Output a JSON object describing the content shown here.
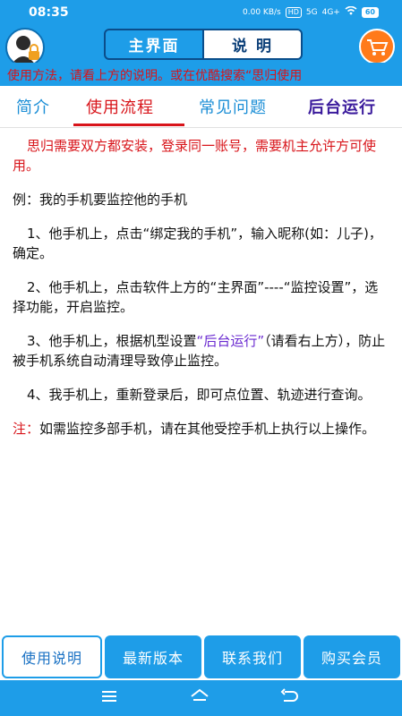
{
  "status_bar": {
    "time": "08:35",
    "net_speed": "0.00 KB/s",
    "hd": "HD",
    "signal_5g": "5G",
    "signal_4g": "4G+",
    "wifi_icon": "wifi-icon",
    "battery": "60"
  },
  "header": {
    "segment_main": "主界面",
    "segment_help": "说 明",
    "avatar_icon": "user-lock-avatar-icon",
    "cart_icon": "shopping-cart-icon",
    "marquee": "使用方法，请看上方的说明。或在优酷搜索“思归使用",
    "accent_color": "#1e9de8"
  },
  "tabs": [
    {
      "label": "简介"
    },
    {
      "label": "使用流程"
    },
    {
      "label": "常见问题"
    },
    {
      "label": "后台运行"
    }
  ],
  "content": {
    "intro": "思归需要双方都安装，登录同一账号，需要机主允许方可使用。",
    "example": "例：我的手机要监控他的手机",
    "step1": "1、他手机上，点击“绑定我的手机”，输入昵称(如：儿子)，确定。",
    "step2": "2、他手机上，点击软件上方的“主界面”----“监控设置”，选择功能，开启监控。",
    "step3_a": "3、他手机上，根据机型设置",
    "step3_link": "“后台运行”",
    "step3_b": "（请看右上方），防止被手机系统自动清理导致停止监控。",
    "step4": "4、我手机上，重新登录后，即可点位置、轨迹进行查询。",
    "note_label": "注：",
    "note_text": "如需监控多部手机，请在其他受控手机上执行以上操作。"
  },
  "bottom_tabs": [
    {
      "label": "使用说明"
    },
    {
      "label": "最新版本"
    },
    {
      "label": "联系我们"
    },
    {
      "label": "购买会员"
    }
  ],
  "nav": {
    "menu_icon": "menu-icon",
    "home_icon": "home-icon",
    "back_icon": "back-icon"
  }
}
